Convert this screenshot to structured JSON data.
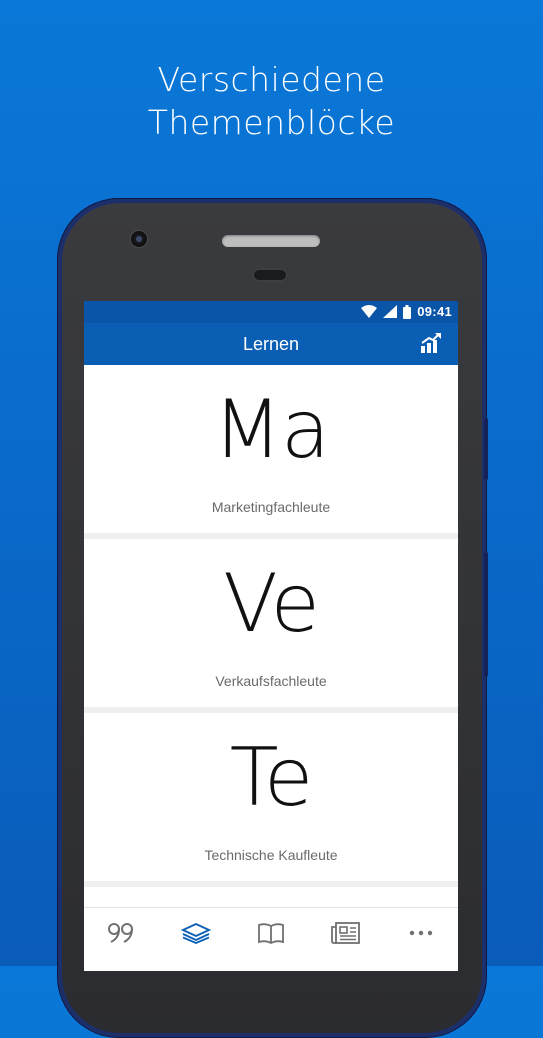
{
  "headline": {
    "line1": "Verschiedene",
    "line2": "Themenblöcke"
  },
  "statusbar": {
    "time": "09:41"
  },
  "appbar": {
    "title": "Lernen"
  },
  "cards": [
    {
      "abbr": "Ma",
      "label": "Marketingfachleute"
    },
    {
      "abbr": "Ve",
      "label": "Verkaufsfachleute"
    },
    {
      "abbr": "Te",
      "label": "Technische Kaufleute"
    }
  ],
  "bottom_nav": [
    {
      "icon": "quote-icon",
      "active": false
    },
    {
      "icon": "layers-icon",
      "active": true
    },
    {
      "icon": "book-icon",
      "active": false
    },
    {
      "icon": "newspaper-icon",
      "active": false
    },
    {
      "icon": "more-icon",
      "active": false
    }
  ],
  "colors": {
    "background": "#0a6cd0",
    "appbar": "#0a5fb5",
    "statusbar": "#0b55a8",
    "active_nav": "#0a5fb5",
    "inactive_nav": "#707070"
  }
}
